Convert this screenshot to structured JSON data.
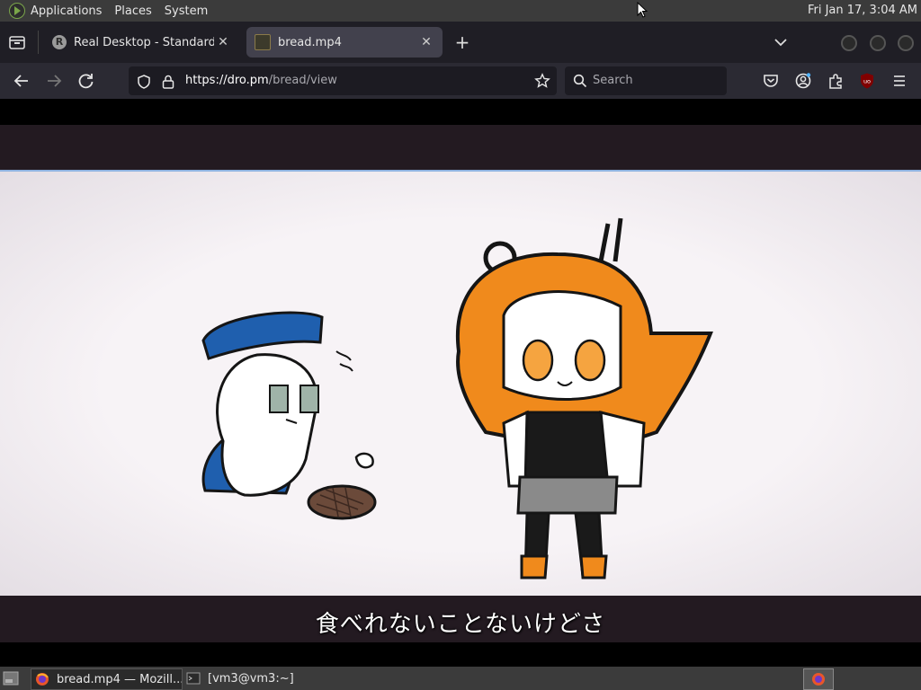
{
  "system_panel": {
    "menus": [
      "Applications",
      "Places",
      "System"
    ],
    "clock": "Fri Jan 17,  3:04 AM"
  },
  "browser": {
    "tabs": [
      {
        "title": "Real Desktop - Standard",
        "favicon_letter": "R"
      },
      {
        "title": "bread.mp4"
      }
    ],
    "url": {
      "domain": "https://dro.pm",
      "path": "/bread/view"
    },
    "search_placeholder": "Search"
  },
  "video": {
    "subtitle": "食べれないことないけどさ",
    "colors": {
      "letterbox": "#231a21",
      "frame": "#f7f3f6",
      "hair_orange": "#f08a1c",
      "hat_blue": "#1f5fae"
    }
  },
  "taskbar": {
    "tasks": [
      {
        "label": "bread.mp4 — Mozill..."
      },
      {
        "label": "[vm3@vm3:~]"
      }
    ]
  }
}
